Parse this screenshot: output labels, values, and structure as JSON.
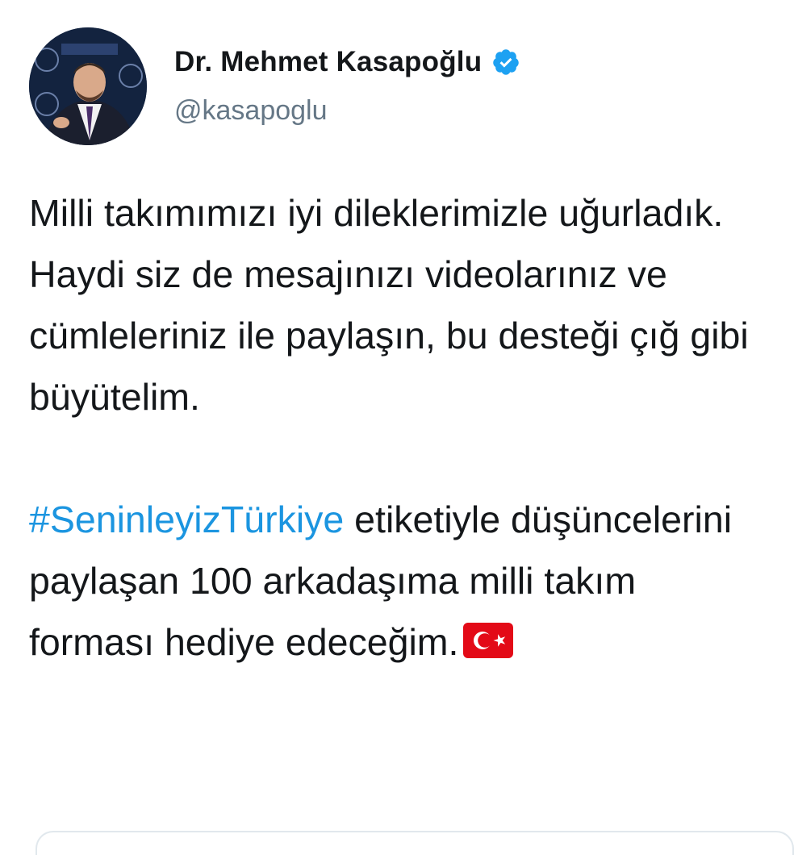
{
  "author": {
    "display_name": "Dr. Mehmet Kasapoğlu",
    "handle": "@kasapoglu",
    "verified_icon": "verified-badge-icon",
    "avatar_icon": "profile-photo"
  },
  "tweet": {
    "para1": "Milli takımımızı iyi dileklerimizle uğurladık. Haydi siz de mesajınızı videolarınız ve cümleleriniz ile paylaşın, bu desteği çığ gibi büyütelim.",
    "hashtag": "#SeninleyizTürkiye",
    "para2_rest": " etiketiyle düşüncelerini paylaşan 100 arkadaşıma milli takım forması hediye edeceğim.",
    "emoji": "turkey-flag-emoji"
  },
  "colors": {
    "hashtag": "#1b95e0",
    "verified": "#1da1f2",
    "handle": "#657786",
    "text": "#14171a",
    "flag_red": "#e30a17"
  }
}
